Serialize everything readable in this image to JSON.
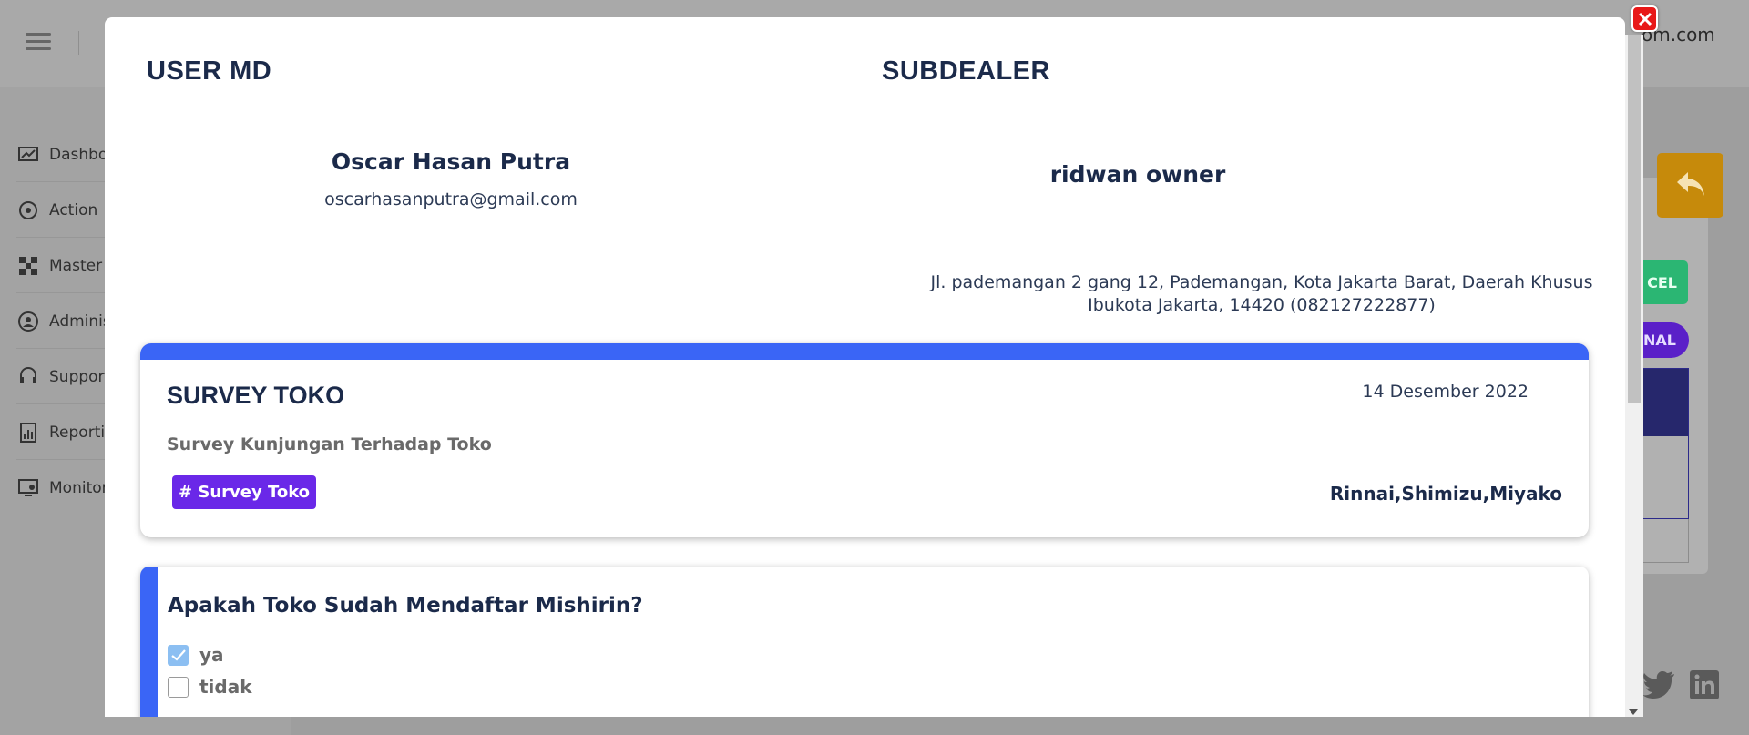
{
  "background": {
    "email_fragment": "om.com",
    "sidebar": [
      {
        "label": "Dashbo",
        "icon": "dashboard-icon"
      },
      {
        "label": "Action",
        "icon": "action-icon"
      },
      {
        "label": "Master",
        "icon": "master-icon"
      },
      {
        "label": "Adminis",
        "icon": "administration-icon"
      },
      {
        "label": "Support",
        "icon": "support-icon"
      },
      {
        "label": "Reportin",
        "icon": "reporting-icon"
      },
      {
        "label": "Monitor",
        "icon": "monitoring-icon"
      }
    ],
    "excel_label": "CEL",
    "final_label": "NAL"
  },
  "modal": {
    "user_md": {
      "title": "USER MD",
      "name": "Oscar Hasan Putra",
      "email": "oscarhasanputra@gmail.com"
    },
    "subdealer": {
      "title": "SUBDEALER",
      "name": "ridwan owner",
      "address_line1": "Jl. pademangan 2 gang 12, Pademangan, Kota Jakarta Barat, Daerah Khusus",
      "address_line2": "Ibukota Jakarta, 14420 (082127222877)"
    },
    "survey": {
      "title": "SURVEY TOKO",
      "date": "14 Desember 2022",
      "description": "Survey Kunjungan Terhadap Toko",
      "tag": "# Survey Toko",
      "brands": "Rinnai,Shimizu,Miyako"
    },
    "question": {
      "text": "Apakah Toko Sudah Mendaftar Mishirin?",
      "options": [
        {
          "label": "ya",
          "checked": true
        },
        {
          "label": "tidak",
          "checked": false
        }
      ]
    }
  },
  "colors": {
    "accent_blue": "#3a65f6",
    "tag_purple": "#6a28e8",
    "close_red": "#e81818",
    "back_button": "#c68a0b"
  }
}
